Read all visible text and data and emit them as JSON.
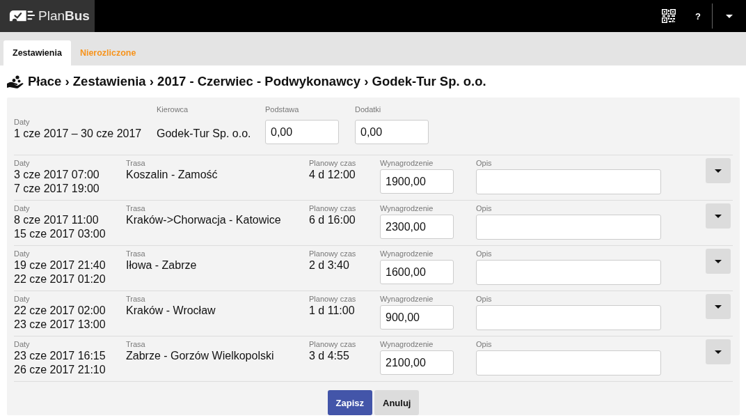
{
  "top_bar": {
    "logo": "Plan**Bus**",
    "help": "?"
  },
  "tabs": [
    {
      "label": "Zestawienia",
      "selected": true
    },
    {
      "label": "Nierozliczone",
      "selected": false
    }
  ],
  "breadcrumb": "Płace › Zestawienia › 2017 - Czerwiec - Podwykonawcy › Godek-Tur Sp. o.o.",
  "summary": {
    "dates": {
      "label": "Daty",
      "value": "1 cze 2017 – 30 cze 2017"
    },
    "driver": {
      "label": "Kierowca",
      "value": "Godek-Tur Sp. o.o."
    },
    "base": {
      "label": "Podstawa",
      "value": "0,00"
    },
    "extras": {
      "label": "Dodatki",
      "value": "0,00"
    }
  },
  "rows": [
    {
      "dates_label": "Daty",
      "start": "3 cze 2017 07:00",
      "end": "7 cze 2017 19:00",
      "route_label": "Trasa",
      "route": "Koszalin - Zamość",
      "time_label": "Planowy czas",
      "time": "4 d 12:00",
      "pay_label": "Wynagrodzenie",
      "pay": "1900,00",
      "description_label": "Opis"
    },
    {
      "dates_label": "Daty",
      "start": "8 cze 2017 11:00",
      "end": "15 cze 2017 03:00",
      "route_label": "Trasa",
      "route": "Kraków->Chorwacja - Katowice",
      "time_label": "Planowy czas",
      "time": "6 d 16:00",
      "pay_label": "Wynagrodzenie",
      "pay": "2300,00",
      "description_label": "Opis"
    },
    {
      "dates_label": "Daty",
      "start": "19 cze 2017 21:40",
      "end": "22 cze 2017 01:20",
      "route_label": "Trasa",
      "route": "Iłowa - Zabrze",
      "time_label": "Planowy czas",
      "time": "2 d 3:40",
      "pay_label": "Wynagrodzenie",
      "pay": "1600,00",
      "description_label": "Opis"
    },
    {
      "dates_label": "Daty",
      "start": "22 cze 2017 02:00",
      "end": "23 cze 2017 13:00",
      "route_label": "Trasa",
      "route": "Kraków - Wrocław",
      "time_label": "Planowy czas",
      "time": "1 d 11:00",
      "pay_label": "Wynagrodzenie",
      "pay": "900,00",
      "description_label": "Opis"
    },
    {
      "dates_label": "Daty",
      "start": "23 cze 2017 16:15",
      "end": "26 cze 2017 21:10",
      "route_label": "Trasa",
      "route": "Zabrze - Gorzów Wielkopolski",
      "time_label": "Planowy czas",
      "time": "3 d 4:55",
      "pay_label": "Wynagrodzenie",
      "pay": "2100,00",
      "description_label": "Opis"
    }
  ],
  "buttons": [
    {
      "label": "Zapisz",
      "kind": "primary"
    },
    {
      "label": "Anuluj",
      "kind": "secondary"
    }
  ]
}
